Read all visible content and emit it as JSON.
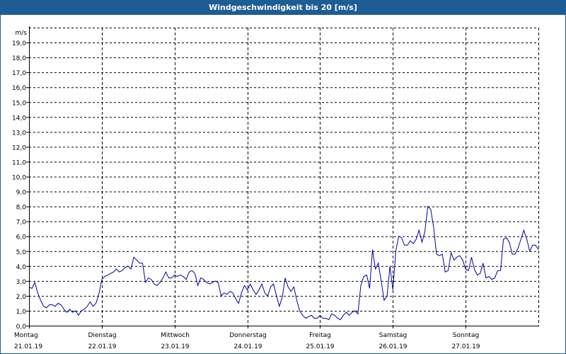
{
  "title": "Windgeschwindigkeit bis 20 [m/s]",
  "colors": {
    "titlebar": "#1d5c94",
    "line": "#0000a0",
    "grid": "#000000"
  },
  "chart_data": {
    "type": "line",
    "title": "Windgeschwindigkeit bis 20 [m/s]",
    "ylabel": "m/s",
    "ylim": [
      0,
      20
    ],
    "xlim": [
      0,
      7
    ],
    "grid": true,
    "y_ticks": [
      "0,0",
      "1,0",
      "2,0",
      "3,0",
      "4,0",
      "5,0",
      "6,0",
      "7,0",
      "8,0",
      "9,0",
      "10,0",
      "11,0",
      "12,0",
      "13,0",
      "14,0",
      "15,0",
      "16,0",
      "17,0",
      "18,0",
      "19,0"
    ],
    "x_days": [
      {
        "day": "Montag",
        "date": "21.01.19"
      },
      {
        "day": "Dienstag",
        "date": "22.01.19"
      },
      {
        "day": "Mittwoch",
        "date": "23.01.19"
      },
      {
        "day": "Donnerstag",
        "date": "24.01.19"
      },
      {
        "day": "Freitag",
        "date": "25.01.19"
      },
      {
        "day": "Samstag",
        "date": "26.01.19"
      },
      {
        "day": "Sonntag",
        "date": "27.01.19"
      }
    ],
    "series": [
      {
        "x": [
          0,
          0.04,
          0.08,
          0.12,
          0.16,
          0.2,
          0.24,
          0.28,
          0.32,
          0.36,
          0.4,
          0.44,
          0.48,
          0.52,
          0.56,
          0.6,
          0.64,
          0.68,
          0.72,
          0.76,
          0.8,
          0.84,
          0.88,
          0.92,
          0.96,
          1.0,
          1.04,
          1.08,
          1.12,
          1.16,
          1.2,
          1.24,
          1.28,
          1.32,
          1.36,
          1.4,
          1.44,
          1.48,
          1.52,
          1.56,
          1.6,
          1.64,
          1.68,
          1.72,
          1.76,
          1.8,
          1.84,
          1.88,
          1.92,
          1.96,
          2.0,
          2.04,
          2.08,
          2.12,
          2.16,
          2.2,
          2.24,
          2.28,
          2.32,
          2.36,
          2.4,
          2.44,
          2.48,
          2.52,
          2.56,
          2.6,
          2.64,
          2.68,
          2.72,
          2.76,
          2.8,
          2.84,
          2.88,
          2.92,
          2.96,
          3.0,
          3.04,
          3.08,
          3.12,
          3.16,
          3.2,
          3.24,
          3.28,
          3.32,
          3.36,
          3.4,
          3.44,
          3.48,
          3.52,
          3.56,
          3.6,
          3.64,
          3.68,
          3.72,
          3.76,
          3.8,
          3.84,
          3.88,
          3.92,
          3.96,
          4.0,
          4.04,
          4.08,
          4.12,
          4.16,
          4.2,
          4.24,
          4.28,
          4.32,
          4.36,
          4.4,
          4.44,
          4.48,
          4.52,
          4.56,
          4.6,
          4.64,
          4.68,
          4.72,
          4.76,
          4.8,
          4.84,
          4.88,
          4.92,
          4.96,
          5.0,
          5.04,
          5.08,
          5.12,
          5.16,
          5.2,
          5.24,
          5.28,
          5.32,
          5.36,
          5.4,
          5.44,
          5.48,
          5.52,
          5.56,
          5.6,
          5.64,
          5.68,
          5.72,
          5.76,
          5.8,
          5.84,
          5.88,
          5.92,
          5.96,
          6.0,
          6.04,
          6.08,
          6.12,
          6.16,
          6.2,
          6.24,
          6.28,
          6.32,
          6.36,
          6.4,
          6.44,
          6.48,
          6.52,
          6.56,
          6.6,
          6.64,
          6.68,
          6.72,
          6.76,
          6.8,
          6.84,
          6.88,
          6.92,
          6.96,
          7.0
        ],
        "values": [
          2.6,
          2.5,
          2.9,
          2.2,
          1.7,
          1.3,
          1.2,
          1.4,
          1.4,
          1.3,
          1.5,
          1.4,
          1.1,
          0.9,
          1.1,
          0.9,
          1.0,
          0.7,
          1.0,
          1.1,
          1.3,
          1.6,
          1.3,
          1.5,
          2.1,
          3.1,
          3.3,
          3.4,
          3.5,
          3.6,
          3.8,
          3.6,
          3.7,
          3.9,
          4.0,
          3.8,
          4.6,
          4.4,
          4.2,
          4.2,
          2.9,
          3.2,
          3.1,
          2.8,
          2.7,
          2.9,
          3.2,
          3.6,
          3.2,
          3.2,
          3.4,
          3.3,
          3.4,
          3.3,
          3.1,
          3.6,
          3.7,
          3.5,
          2.7,
          3.2,
          3.1,
          2.9,
          2.8,
          2.9,
          3.0,
          2.9,
          2.0,
          2.2,
          2.1,
          2.3,
          2.2,
          1.8,
          1.5,
          2.2,
          2.7,
          2.4,
          2.8,
          2.4,
          2.1,
          2.4,
          2.8,
          2.2,
          2.0,
          2.6,
          2.8,
          2.0,
          1.3,
          1.9,
          3.2,
          2.6,
          2.3,
          2.6,
          1.7,
          1.0,
          0.7,
          0.5,
          0.6,
          0.7,
          0.5,
          0.5,
          0.7,
          0.5,
          0.5,
          0.4,
          0.8,
          0.7,
          0.5,
          0.4,
          0.7,
          0.9,
          0.7,
          0.9,
          1.0,
          0.8,
          2.7,
          3.3,
          3.4,
          2.5,
          5.1,
          3.8,
          4.2,
          3.0,
          1.7,
          2.0,
          4.0,
          2.4,
          5.0,
          6.0,
          5.9,
          5.4,
          5.4,
          5.7,
          5.5,
          5.8,
          6.4,
          5.6,
          6.3,
          8.0,
          7.8,
          6.6,
          4.8,
          4.7,
          4.8,
          3.6,
          3.7,
          4.9,
          4.4,
          4.6,
          4.7,
          4.4,
          3.8,
          3.7,
          4.6,
          3.8,
          3.4,
          3.5,
          4.2,
          3.2,
          3.3,
          3.1,
          3.2,
          3.7,
          3.7,
          5.8,
          5.9,
          5.6,
          4.8,
          4.8,
          5.2,
          5.8,
          6.4,
          5.8,
          5.0,
          5.4,
          5.4,
          5.1
        ]
      }
    ]
  }
}
